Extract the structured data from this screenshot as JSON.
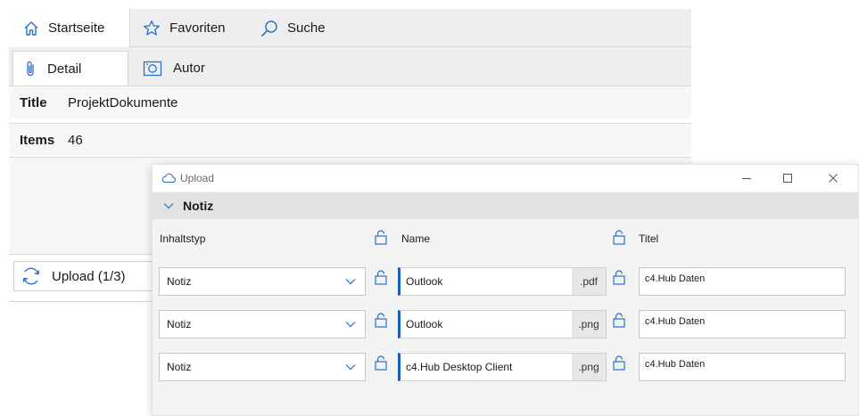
{
  "app": {
    "nav": [
      {
        "label": "Startseite",
        "icon": "home-icon",
        "active": true
      },
      {
        "label": "Favoriten",
        "icon": "star-icon",
        "active": false
      },
      {
        "label": "Suche",
        "icon": "search-icon",
        "active": false
      }
    ],
    "subtabs": [
      {
        "label": "Detail",
        "icon": "paperclip-icon",
        "active": true
      },
      {
        "label": "Autor",
        "icon": "camera-icon",
        "active": false
      }
    ],
    "properties": [
      {
        "key": "Title",
        "value": "ProjektDokumente"
      },
      {
        "key": "Items",
        "value": "46"
      }
    ],
    "upload_status": "Upload (1/3)"
  },
  "dialog": {
    "title": "Upload",
    "section_title": "Notiz",
    "columns": {
      "content_type": "Inhaltstyp",
      "name": "Name",
      "title": "Titel"
    },
    "rows": [
      {
        "content_type": "Notiz",
        "name": "Outlook",
        "extension": ".pdf",
        "title": "c4.Hub Daten"
      },
      {
        "content_type": "Notiz",
        "name": "Outlook",
        "extension": ".png",
        "title": "c4.Hub Daten"
      },
      {
        "content_type": "Notiz",
        "name": "c4.Hub Desktop Client",
        "extension": ".png",
        "title": "c4.Hub Daten"
      }
    ]
  },
  "colors": {
    "accent": "#1a5fb4",
    "icon_blue": "#2a6fc9",
    "nav_background": "#eeeeee",
    "section_background": "#e2e2e2"
  }
}
